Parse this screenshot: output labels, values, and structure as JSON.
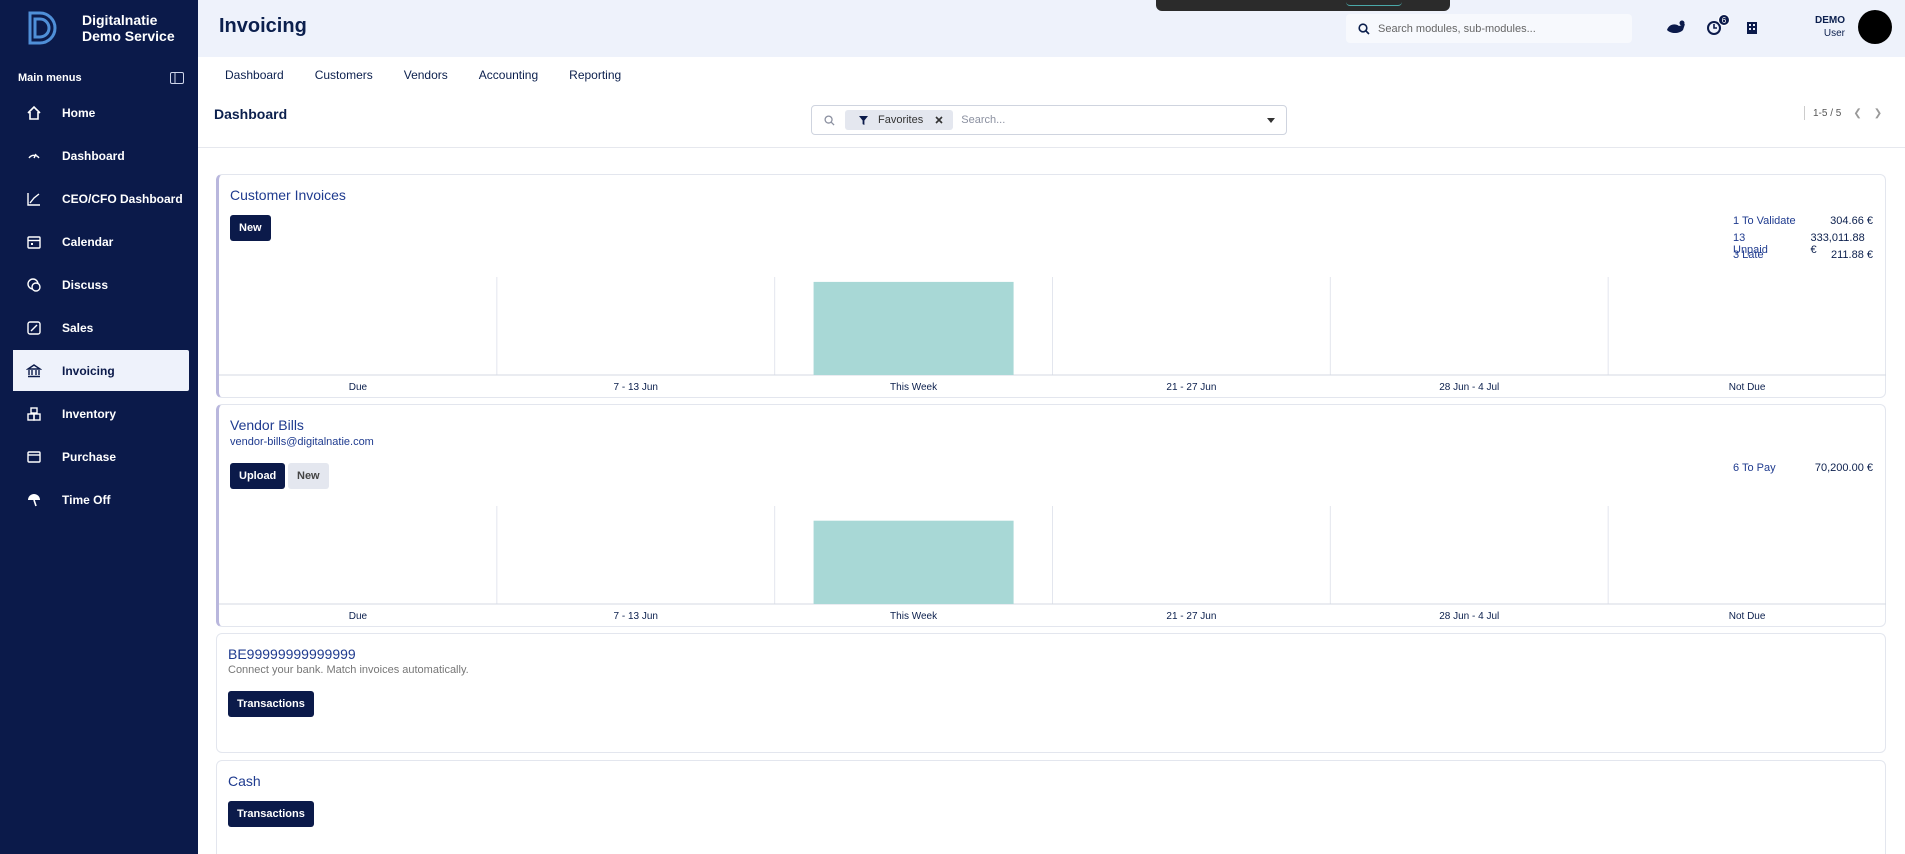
{
  "brand": {
    "line1": "Digitalnatie",
    "line2": "Demo Service"
  },
  "sidebar": {
    "heading": "Main menus",
    "items": [
      {
        "label": "Home",
        "icon": "home-icon"
      },
      {
        "label": "Dashboard",
        "icon": "gauge-icon"
      },
      {
        "label": "CEO/CFO Dashboard",
        "icon": "trend-icon"
      },
      {
        "label": "Calendar",
        "icon": "calendar-icon"
      },
      {
        "label": "Discuss",
        "icon": "chat-icon"
      },
      {
        "label": "Sales",
        "icon": "percent-icon"
      },
      {
        "label": "Invoicing",
        "icon": "bank-icon",
        "active": true
      },
      {
        "label": "Inventory",
        "icon": "boxes-icon"
      },
      {
        "label": "Purchase",
        "icon": "card-icon"
      },
      {
        "label": "Time Off",
        "icon": "umbrella-icon"
      }
    ]
  },
  "topbar": {
    "title": "Invoicing",
    "search_placeholder": "Search modules, sub-modules...",
    "activity_badge": "6",
    "user": {
      "name": "DEMO",
      "role": "User"
    }
  },
  "subnav": [
    "Dashboard",
    "Customers",
    "Vendors",
    "Accounting",
    "Reporting"
  ],
  "control": {
    "breadcrumb": "Dashboard",
    "facet": "Favorites",
    "search_placeholder": "Search...",
    "pager": "1-5 / 5"
  },
  "cards": {
    "customer_invoices": {
      "title": "Customer Invoices",
      "new_label": "New",
      "stats": [
        {
          "label": "1 To Validate",
          "value": "304.66 €"
        },
        {
          "label": "13 Unpaid",
          "value": "333,011.88 €"
        },
        {
          "label": "3 Late",
          "value": "211.88 €"
        }
      ]
    },
    "vendor_bills": {
      "title": "Vendor Bills",
      "email": "vendor-bills@digitalnatie.com",
      "upload_label": "Upload",
      "new_label": "New",
      "stats": [
        {
          "label": "6 To Pay",
          "value": "70,200.00 €"
        }
      ]
    },
    "bank": {
      "title": "BE99999999999999",
      "description": "Connect your bank. Match invoices automatically.",
      "button": "Transactions"
    },
    "cash": {
      "title": "Cash",
      "button": "Transactions"
    }
  },
  "colors": {
    "sidebar": "#0b1a4a",
    "bar": "#a8d8d6",
    "topbar": "#eef2fb"
  },
  "chart_data": [
    {
      "type": "bar",
      "categories": [
        "Due",
        "7 - 13 Jun",
        "This Week",
        "21 - 27 Jun",
        "28 Jun - 4 Jul",
        "Not Due"
      ],
      "values": [
        0,
        0,
        95,
        0,
        0,
        0
      ],
      "ylim": [
        0,
        100
      ]
    },
    {
      "type": "bar",
      "categories": [
        "Due",
        "7 - 13 Jun",
        "This Week",
        "21 - 27 Jun",
        "28 Jun - 4 Jul",
        "Not Due"
      ],
      "values": [
        0,
        0,
        85,
        0,
        0,
        0
      ],
      "ylim": [
        0,
        100
      ]
    }
  ]
}
